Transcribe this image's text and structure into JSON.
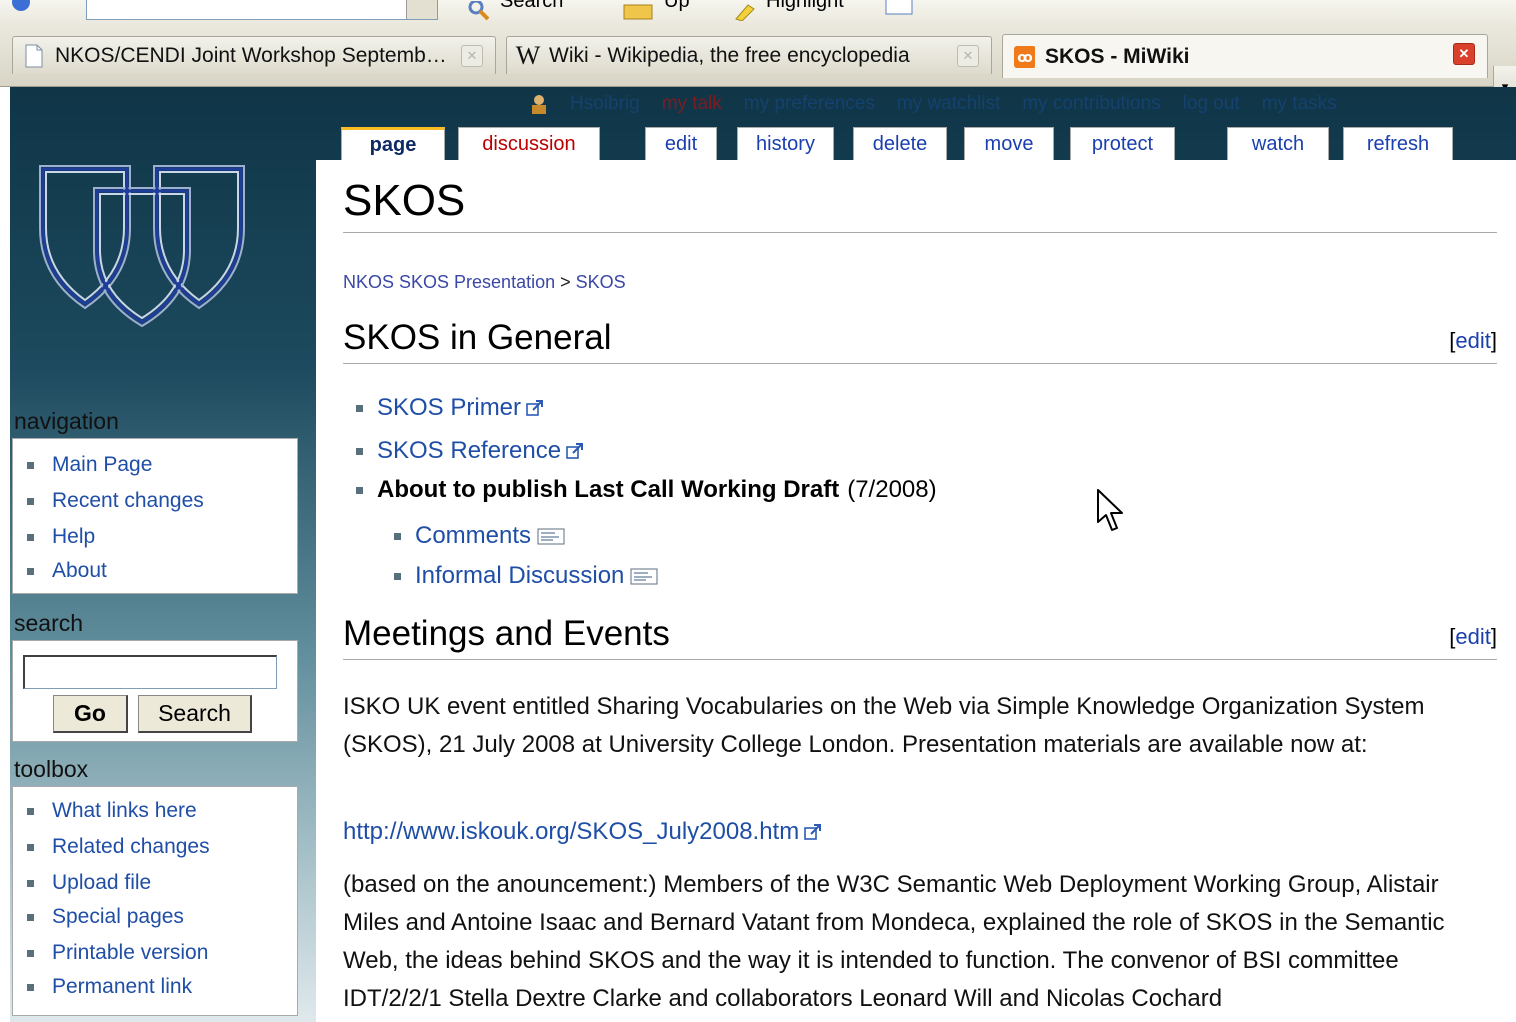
{
  "toolbar": {
    "stubs": [
      "Search",
      "Up",
      "Highlight"
    ]
  },
  "browser_tabs": [
    {
      "label": "NKOS/CENDI Joint Workshop Septemb…",
      "active": false
    },
    {
      "label": "Wiki - Wikipedia, the free encyclopedia",
      "active": false
    },
    {
      "label": "SKOS - MiWiki",
      "active": true
    }
  ],
  "userbar": {
    "links": [
      "Hsoibrig",
      "my talk",
      "my preferences",
      "my watchlist",
      "my contributions",
      "log out",
      "my tasks"
    ]
  },
  "page_tabs": [
    "page",
    "discussion",
    "edit",
    "history",
    "delete",
    "move",
    "protect",
    "watch",
    "refresh"
  ],
  "article": {
    "title": "SKOS",
    "breadcrumb": {
      "parent": "NKOS SKOS Presentation",
      "sep": " > ",
      "current": "SKOS"
    },
    "edit_label": "edit",
    "sections": {
      "general": {
        "heading": "SKOS in General",
        "items": [
          "SKOS Primer",
          "SKOS Reference",
          "About to publish Last Call Working Draft",
          "(7/2008)",
          "Comments",
          "Informal Discussion"
        ]
      },
      "meetings": {
        "heading": "Meetings and Events",
        "para1": "ISKO UK event entitled Sharing Vocabularies on the Web via Simple Knowledge Organization System (SKOS), 21 July 2008 at University College London. Presentation materials are available now at:",
        "url": "http://www.iskouk.org/SKOS_July2008.htm",
        "para2": "(based on the anouncement:) Members of the W3C Semantic Web Deployment Working Group, Alistair Miles and Antoine Isaac and Bernard Vatant from Mondeca, explained the role of SKOS in the Semantic Web, the ideas behind SKOS and the way it is intended to function. The convenor of BSI committee IDT/2/2/1 Stella Dextre Clarke and collaborators Leonard Will and Nicolas Cochard"
      }
    }
  },
  "sidebar": {
    "navigation": {
      "title": "navigation",
      "items": [
        "Main Page",
        "Recent changes",
        "Help",
        "About"
      ]
    },
    "search": {
      "title": "search",
      "go": "Go",
      "search": "Search"
    },
    "toolbox": {
      "title": "toolbox",
      "items": [
        "What links here",
        "Related changes",
        "Upload file",
        "Special pages",
        "Printable version",
        "Permanent link"
      ]
    }
  },
  "colors": {
    "link": "#1f4ea6",
    "new_link": "#ba0000",
    "selected_tab": "#fabd23",
    "sidebar_dark": "#0f3547"
  }
}
